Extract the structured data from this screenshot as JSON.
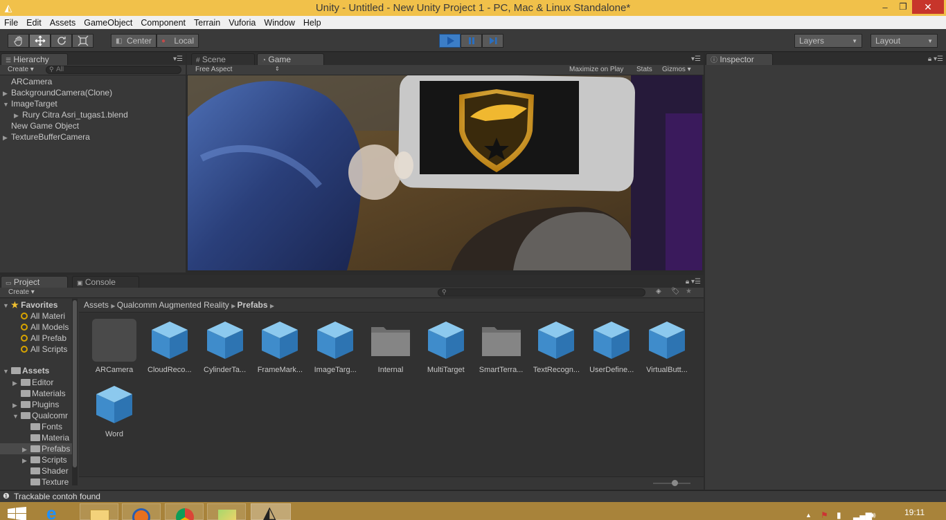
{
  "window": {
    "title": "Unity - Untitled - New Unity Project 1 - PC, Mac & Linux Standalone*",
    "controls": {
      "minimize": "–",
      "maximize": "❐",
      "close": "✕"
    }
  },
  "menu": [
    "File",
    "Edit",
    "Assets",
    "GameObject",
    "Component",
    "Terrain",
    "Vuforia",
    "Window",
    "Help"
  ],
  "toolbar": {
    "pivot": "Center",
    "space": "Local",
    "layers": "Layers",
    "layout": "Layout"
  },
  "hierarchy": {
    "tab": "Hierarchy",
    "create": "Create",
    "search_placeholder": "All",
    "items": [
      {
        "label": "ARCamera",
        "indent": 0,
        "arrow": ""
      },
      {
        "label": "BackgroundCamera(Clone)",
        "indent": 0,
        "arrow": "▶"
      },
      {
        "label": "ImageTarget",
        "indent": 0,
        "arrow": "▼"
      },
      {
        "label": "Rury Citra Asri_tugas1.blend",
        "indent": 1,
        "arrow": "▶"
      },
      {
        "label": "New Game Object",
        "indent": 0,
        "arrow": ""
      },
      {
        "label": "TextureBufferCamera",
        "indent": 0,
        "arrow": "▶"
      }
    ]
  },
  "scene_tabs": {
    "scene": "Scene",
    "game": "Game",
    "aspect": "Free Aspect",
    "maximize": "Maximize on Play",
    "stats": "Stats",
    "gizmos": "Gizmos"
  },
  "inspector": {
    "tab": "Inspector"
  },
  "project": {
    "tab": "Project",
    "console_tab": "Console",
    "create": "Create",
    "breadcrumb": [
      "Assets",
      "Qualcomm Augmented Reality",
      "Prefabs"
    ],
    "favorites_label": "Favorites",
    "favorites": [
      "All Materi",
      "All Models",
      "All Prefab",
      "All Scripts"
    ],
    "assets_label": "Assets",
    "tree": [
      {
        "label": "Editor",
        "indent": 1,
        "arrow": "▶"
      },
      {
        "label": "Materials",
        "indent": 1,
        "arrow": ""
      },
      {
        "label": "Plugins",
        "indent": 1,
        "arrow": "▶"
      },
      {
        "label": "Qualcomr",
        "indent": 1,
        "arrow": "▼"
      },
      {
        "label": "Fonts",
        "indent": 2,
        "arrow": ""
      },
      {
        "label": "Materia",
        "indent": 2,
        "arrow": ""
      },
      {
        "label": "Prefabs",
        "indent": 2,
        "arrow": "▶",
        "selected": true
      },
      {
        "label": "Scripts",
        "indent": 2,
        "arrow": "▶"
      },
      {
        "label": "Shader",
        "indent": 2,
        "arrow": ""
      },
      {
        "label": "Texture",
        "indent": 2,
        "arrow": ""
      }
    ],
    "assets": [
      {
        "label": "ARCamera",
        "kind": "empty"
      },
      {
        "label": "CloudReco...",
        "kind": "cube"
      },
      {
        "label": "CylinderTa...",
        "kind": "cube"
      },
      {
        "label": "FrameMark...",
        "kind": "cube"
      },
      {
        "label": "ImageTarg...",
        "kind": "cube"
      },
      {
        "label": "Internal",
        "kind": "folder"
      },
      {
        "label": "MultiTarget",
        "kind": "cube"
      },
      {
        "label": "SmartTerra...",
        "kind": "folder"
      },
      {
        "label": "TextRecogn...",
        "kind": "cube"
      },
      {
        "label": "UserDefine...",
        "kind": "cube"
      },
      {
        "label": "VirtualButt...",
        "kind": "cube"
      },
      {
        "label": "Word",
        "kind": "cube"
      }
    ]
  },
  "status": {
    "message": "Trackable contoh found"
  },
  "taskbar": {
    "clock": "19:11"
  },
  "colors": {
    "title_bg": "#f1c14a",
    "panel_bg": "#383838",
    "play_blue": "#3c7ec7",
    "cube_blue": "#4a9fd8",
    "taskbar": "#a8833a"
  }
}
